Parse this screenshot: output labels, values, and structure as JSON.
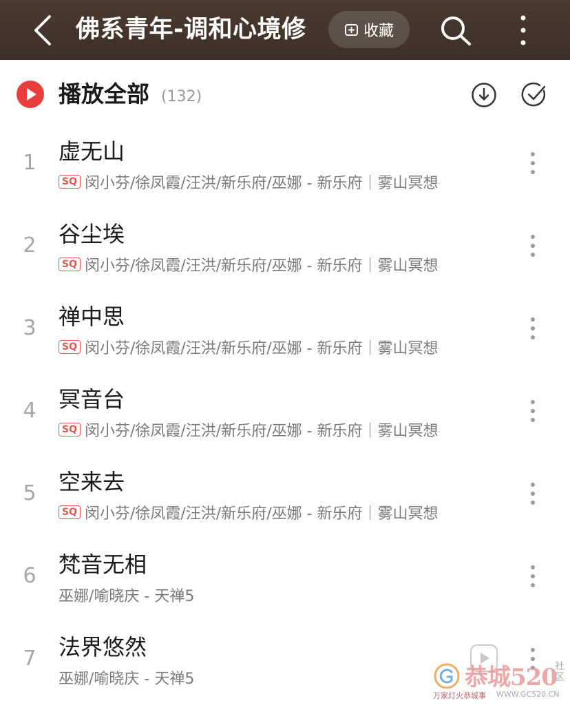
{
  "header": {
    "title": "佛系青年-调和心境修",
    "collect_label": "收藏",
    "icons": {
      "back": "chevron-left-icon",
      "collect": "plus-square-icon",
      "search": "search-icon",
      "more": "more-vertical-icon"
    },
    "colors": {
      "background": "#3d3029"
    }
  },
  "play_all": {
    "label": "播放全部",
    "count": "(132)",
    "icons": {
      "play": "play-circle-icon",
      "download": "download-icon",
      "select": "check-circle-icon"
    },
    "colors": {
      "accent": "#ea3e3c"
    }
  },
  "songs": [
    {
      "index": "1",
      "title": "虚无山",
      "quality": "SQ",
      "subtitle": "闵小芬/徐凤霞/汪洪/新乐府/巫娜 - 新乐府｜雾山冥想"
    },
    {
      "index": "2",
      "title": "谷尘埃",
      "quality": "SQ",
      "subtitle": "闵小芬/徐凤霞/汪洪/新乐府/巫娜 - 新乐府｜雾山冥想"
    },
    {
      "index": "3",
      "title": "禅中思",
      "quality": "SQ",
      "subtitle": "闵小芬/徐凤霞/汪洪/新乐府/巫娜 - 新乐府｜雾山冥想"
    },
    {
      "index": "4",
      "title": "冥音台",
      "quality": "SQ",
      "subtitle": "闵小芬/徐凤霞/汪洪/新乐府/巫娜 - 新乐府｜雾山冥想"
    },
    {
      "index": "5",
      "title": "空来去",
      "quality": "SQ",
      "subtitle": "闵小芬/徐凤霞/汪洪/新乐府/巫娜 - 新乐府｜雾山冥想"
    },
    {
      "index": "6",
      "title": "梵音无相",
      "quality": "",
      "subtitle": "巫娜/喻晓庆 - 天禅5"
    },
    {
      "index": "7",
      "title": "法界悠然",
      "quality": "",
      "subtitle": "巫娜/喻晓庆 - 天禅5"
    }
  ],
  "song_more_icon": "more-vertical-icon",
  "floating_player_icon": "video-play-icon",
  "watermark": {
    "text": "恭城520",
    "side": "社区",
    "subtitle": "万家灯火恭城事",
    "url": "WWW.GC520.CN"
  }
}
